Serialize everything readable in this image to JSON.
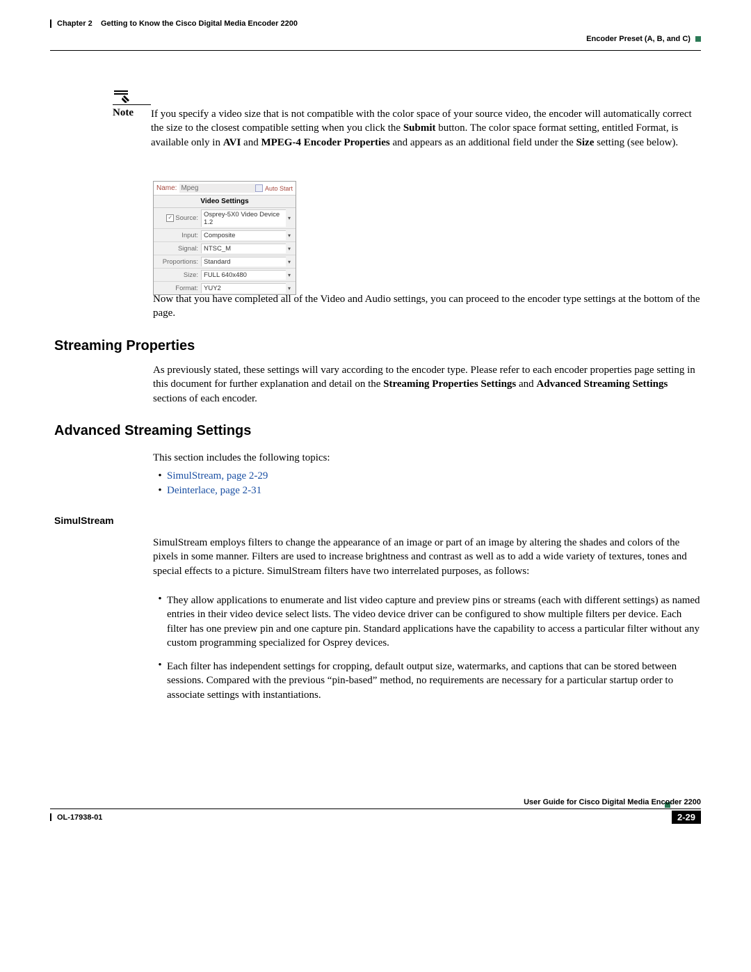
{
  "header": {
    "chapter_ref": "Chapter 2",
    "chapter_title": "Getting to Know the Cisco Digital Media Encoder 2200",
    "section_title": "Encoder Preset (A, B, and C)"
  },
  "note": {
    "label": "Note",
    "text_1": "If you specify a video size that is not compatible with the color space of your source video, the encoder will automatically correct the size to the closest compatible setting when you click the ",
    "bold_submit": "Submit",
    "text_2": " button. The color space format setting, entitled Format, is available only in ",
    "bold_avi": "AVI",
    "text_3": " and ",
    "bold_mpeg4": "MPEG-4 Encoder Properties",
    "text_4": " and appears as an additional field under the ",
    "bold_size": "Size",
    "text_5": " setting (see below)."
  },
  "figure": {
    "name_label": "Name:",
    "name_value": "Mpeg",
    "auto_start": "Auto Start",
    "video_settings": "Video Settings",
    "rows": [
      {
        "checkbox": true,
        "checked": true,
        "label": "Source:",
        "value": "Osprey-5X0 Video Device 1.2",
        "dropdown": true
      },
      {
        "checkbox": false,
        "label": "Input:",
        "value": "Composite",
        "dropdown": true
      },
      {
        "checkbox": false,
        "label": "Signal:",
        "value": "NTSC_M",
        "dropdown": true
      },
      {
        "checkbox": false,
        "label": "Proportions:",
        "value": "Standard",
        "dropdown": true
      },
      {
        "checkbox": false,
        "label": "Size:",
        "value": "FULL 640x480",
        "dropdown": true
      },
      {
        "checkbox": false,
        "label": "Format:",
        "value": "YUY2",
        "dropdown": true
      }
    ]
  },
  "after_figure": "Now that you have completed all of the Video and Audio settings, you can proceed to the encoder type settings at the bottom of the page.",
  "streaming_properties": {
    "heading": "Streaming Properties",
    "body_1": "As previously stated, these settings will vary according to the encoder type. Please refer to each encoder properties page setting in this document for further explanation and detail on the ",
    "bold_a": "Streaming Properties Settings",
    "body_2": " and ",
    "bold_b": "Advanced Streaming Settings",
    "body_3": " sections of each encoder."
  },
  "advanced": {
    "heading": "Advanced Streaming Settings",
    "intro": "This section includes the following topics:",
    "links": [
      "SimulStream, page 2-29",
      "Deinterlace, page 2-31"
    ]
  },
  "simulstream": {
    "heading": "SimulStream",
    "body": "SimulStream employs filters to change the appearance of an image or part of an image by altering the shades and colors of the pixels in some manner. Filters are used to increase brightness and contrast as well as to add a wide variety of textures, tones and special effects to a picture. SimulStream filters have two interrelated purposes, as follows:",
    "bullets": [
      "They allow applications to enumerate and list video capture and preview pins or streams (each with different settings) as named entries in their video device select lists. The video device driver can be configured to show multiple filters per device. Each filter has one preview pin and one capture pin. Standard applications have the capability to access a particular filter without any custom programming specialized for Osprey devices.",
      "Each filter has independent settings for cropping, default output size, watermarks, and captions that can be stored between sessions. Compared with the previous “pin-based” method, no requirements are necessary for a particular startup order to associate settings with instantiations."
    ]
  },
  "footer": {
    "guide": "User Guide for Cisco Digital Media Encoder 2200",
    "doc_id": "OL-17938-01",
    "page_num": "2-29"
  }
}
